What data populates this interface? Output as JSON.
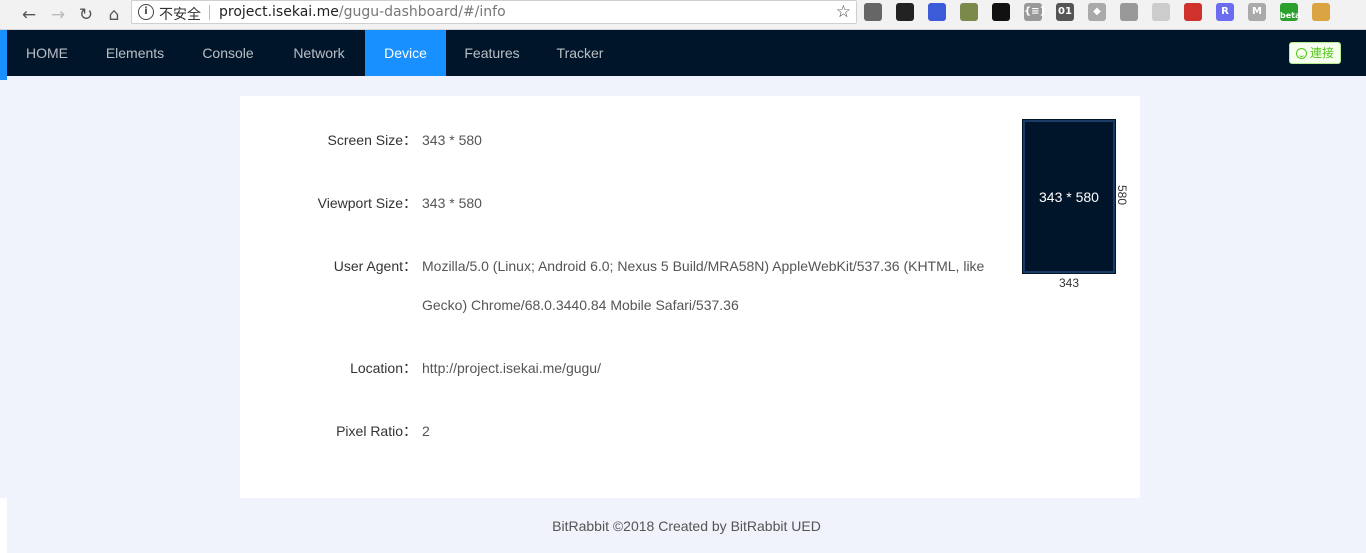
{
  "browser": {
    "insecure_label": "不安全",
    "url_host": "project.isekai.me",
    "url_path": "/gugu-dashboard/#/info",
    "extensions": [
      {
        "icon": "gear-extension-icon",
        "text": "",
        "color": "#666666"
      },
      {
        "icon": "color-wheel-extension-icon",
        "text": "",
        "color": "#222222"
      },
      {
        "icon": "moon-extension-icon",
        "text": "",
        "color": "#3b5bd9"
      },
      {
        "icon": "leaf-extension-icon",
        "text": "",
        "color": "#7a8a4a"
      },
      {
        "icon": "ghost-extension-icon",
        "text": "",
        "color": "#111111"
      },
      {
        "icon": "json-extension-icon",
        "text": "{≡}",
        "color": "#999999"
      },
      {
        "icon": "binary-extension-icon",
        "text": "01",
        "color": "#555555"
      },
      {
        "icon": "diamond-extension-icon",
        "text": "◆",
        "color": "#aaaaaa"
      },
      {
        "icon": "grid-extension-icon",
        "text": "",
        "color": "#999999"
      },
      {
        "icon": "list-extension-icon",
        "text": "",
        "color": "#cccccc"
      },
      {
        "icon": "book-extension-icon",
        "text": "",
        "color": "#d0312d"
      },
      {
        "icon": "r-extension-icon",
        "text": "R",
        "color": "#6c6cf0"
      },
      {
        "icon": "m-extension-icon",
        "text": "M",
        "color": "#aaaaaa"
      },
      {
        "icon": "beta-extension-icon",
        "text": "beta",
        "color": "#2ca02c"
      },
      {
        "icon": "cookie-extension-icon",
        "text": "",
        "color": "#d9a441"
      }
    ]
  },
  "nav": {
    "items": [
      {
        "label": "HOME",
        "active": false
      },
      {
        "label": "Elements",
        "active": false
      },
      {
        "label": "Console",
        "active": false
      },
      {
        "label": "Network",
        "active": false
      },
      {
        "label": "Device",
        "active": true
      },
      {
        "label": "Features",
        "active": false
      },
      {
        "label": "Tracker",
        "active": false
      }
    ],
    "connect_label": "連接"
  },
  "device": {
    "screen_size_label": "Screen Size：",
    "screen_size": "343 * 580",
    "viewport_size_label": "Viewport Size：",
    "viewport_size": "343 * 580",
    "user_agent_label": "User Agent：",
    "user_agent": "Mozilla/5.0 (Linux; Android 6.0; Nexus 5 Build/MRA58N) AppleWebKit/537.36 (KHTML, like Gecko) Chrome/68.0.3440.84 Mobile Safari/537.36",
    "location_label": "Location：",
    "location": "http://project.isekai.me/gugu/",
    "pixel_ratio_label": "Pixel Ratio：",
    "pixel_ratio": "2",
    "preview": {
      "text": "343 * 580",
      "width": "343",
      "height": "580"
    }
  },
  "footer": "BitRabbit ©2018 Created by BitRabbit UED",
  "colors": {
    "nav_bg": "#001529",
    "accent": "#1890ff",
    "connect_green": "#52c41a",
    "page_bg": "#f0f2fc"
  }
}
